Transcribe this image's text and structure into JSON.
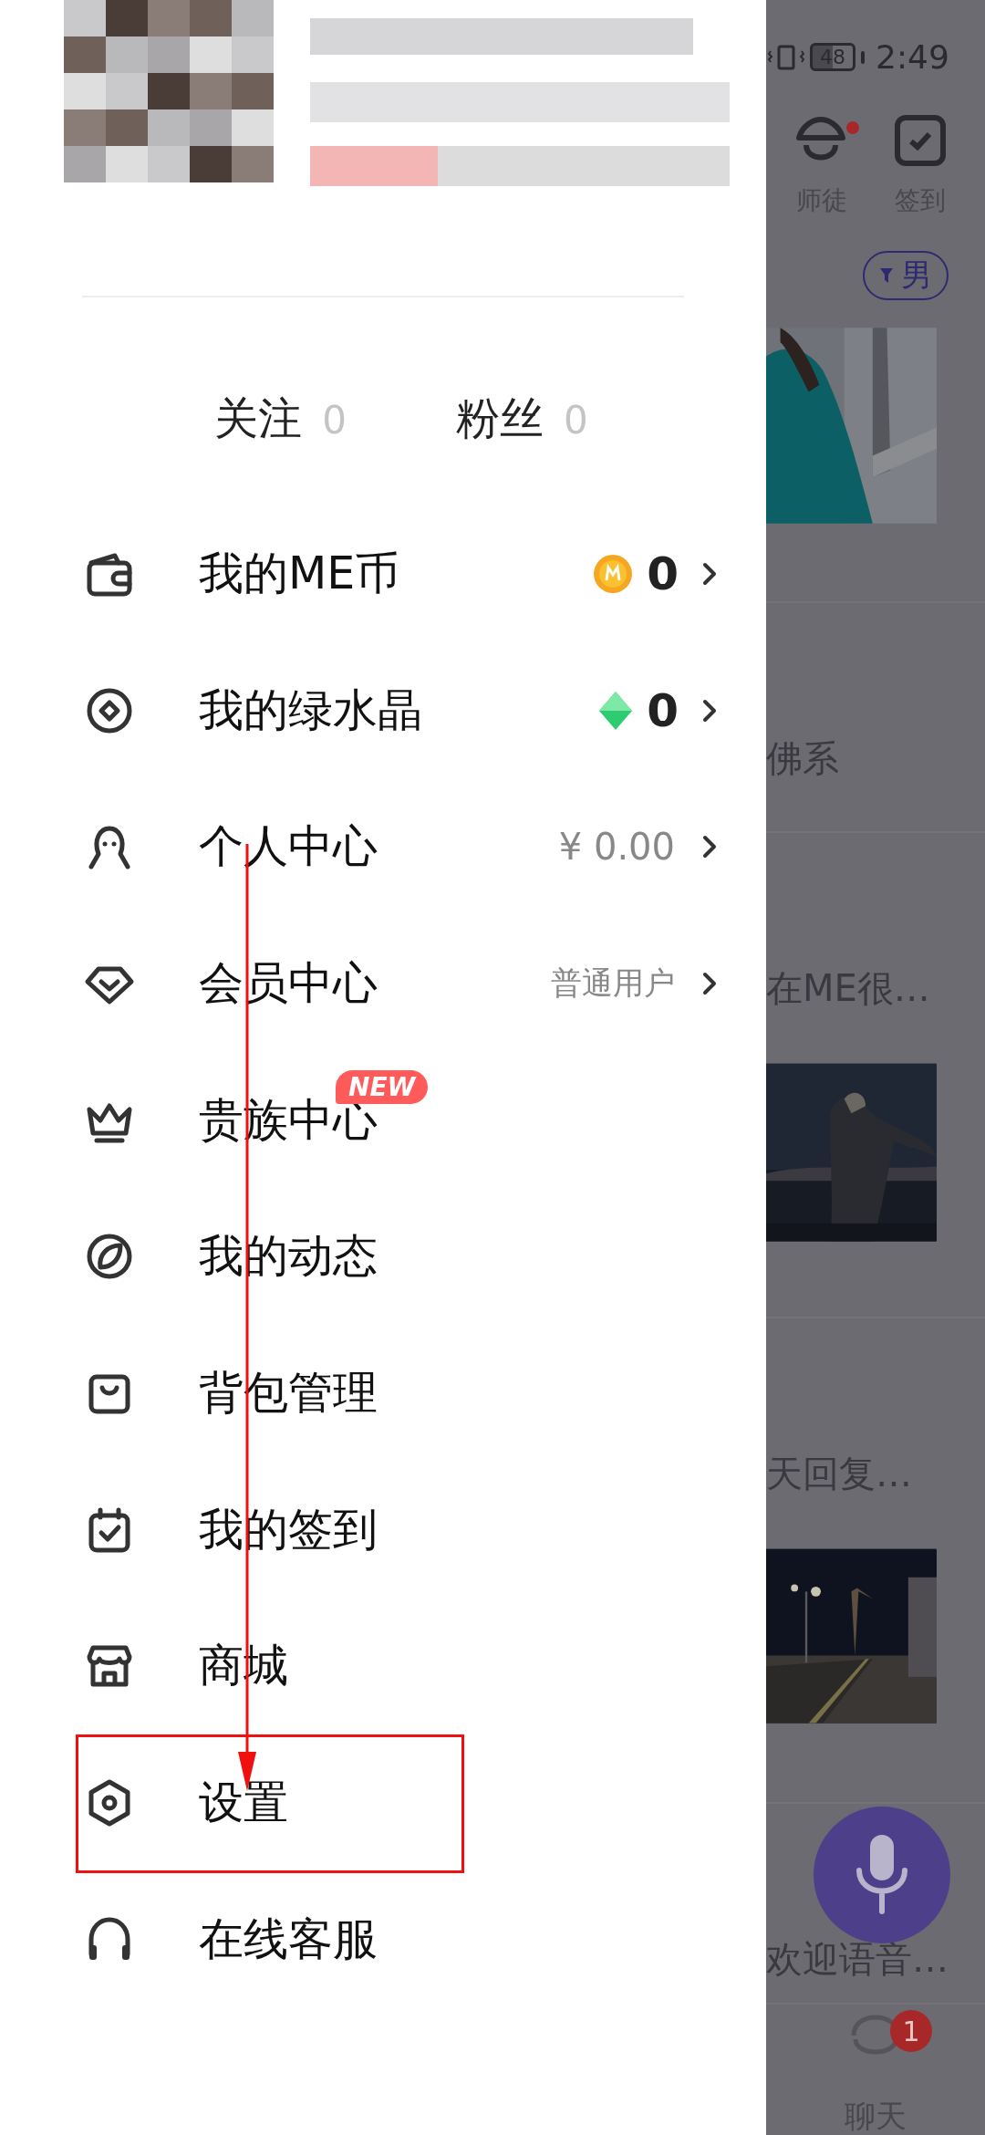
{
  "status_bar": {
    "battery": "48",
    "time": "2:49"
  },
  "follow": [
    {
      "label": "关注",
      "count": "0"
    },
    {
      "label": "粉丝",
      "count": "0"
    }
  ],
  "menu": [
    {
      "label": "我的ME币",
      "kind": "coin",
      "value": "0",
      "highlighted": false
    },
    {
      "label": "我的绿水晶",
      "kind": "gem",
      "value": "0",
      "highlighted": false
    },
    {
      "label": "个人中心",
      "kind": "money",
      "value": "¥ 0.00",
      "highlighted": false
    },
    {
      "label": "会员中心",
      "kind": "text",
      "value": "普通用户",
      "highlighted": false
    },
    {
      "label": "贵族中心",
      "badge": "NEW",
      "highlighted": false
    },
    {
      "label": "我的动态",
      "highlighted": false
    },
    {
      "label": "背包管理",
      "highlighted": false
    },
    {
      "label": "我的签到",
      "highlighted": false
    },
    {
      "label": "商城",
      "highlighted": false
    },
    {
      "label": "设置",
      "highlighted": true
    },
    {
      "label": "在线客服",
      "highlighted": false
    }
  ],
  "background": {
    "top_icons": [
      {
        "label": "师徒",
        "dot": true
      },
      {
        "label": "签到",
        "dot": false
      }
    ],
    "filter": "男",
    "feed": [
      {
        "kind": "picture"
      },
      {
        "kind": "text",
        "text": "佛系"
      },
      {
        "kind": "text",
        "text": "在ME很…"
      },
      {
        "kind": "picture"
      },
      {
        "kind": "text",
        "text": "天回复…"
      },
      {
        "kind": "picture"
      },
      {
        "kind": "text",
        "text": "欢迎语音…"
      }
    ],
    "nav": {
      "label": "聊天",
      "badge": "1"
    }
  }
}
